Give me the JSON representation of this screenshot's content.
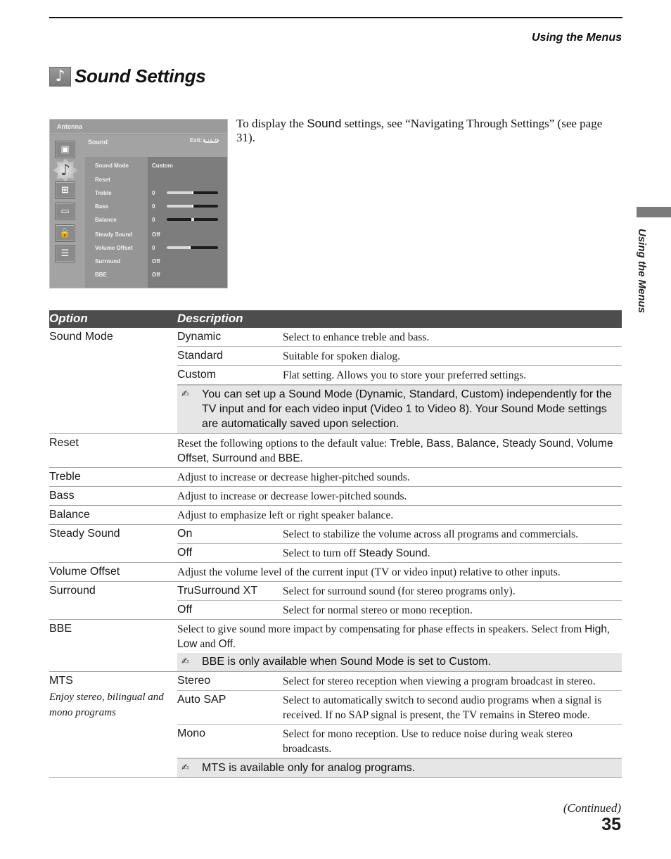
{
  "running_head": "Using the Menus",
  "section": {
    "icon": "music-note-icon",
    "icon_glyph": "♪",
    "title": "Sound Settings"
  },
  "tv_menu": {
    "source": "Antenna",
    "title": "Sound",
    "exit_label": "Exit:",
    "exit_key": "MENU",
    "rail_icons": [
      {
        "name": "picture-icon",
        "glyph": "▣"
      },
      {
        "name": "sound-icon",
        "glyph": "♪",
        "active": true
      },
      {
        "name": "screen-icon",
        "glyph": "⊞"
      },
      {
        "name": "channel-icon",
        "glyph": "▭"
      },
      {
        "name": "parental-lock-icon",
        "glyph": "🔒"
      },
      {
        "name": "setup-icon",
        "glyph": "☰"
      }
    ],
    "items": [
      {
        "label": "Sound Mode",
        "value": "Custom"
      },
      {
        "label": "Reset",
        "value": ""
      },
      {
        "label": "Treble",
        "value": "0",
        "slider": 0.5
      },
      {
        "label": "Bass",
        "value": "0",
        "slider": 0.5
      },
      {
        "label": "Balance",
        "value": "0",
        "balance": 0.5
      },
      {
        "label": "Steady Sound",
        "value": "Off"
      },
      {
        "label": "Volume Offset",
        "value": "0",
        "slider": 0.45
      },
      {
        "label": "Surround",
        "value": "Off"
      },
      {
        "label": "BBE",
        "value": "Off"
      }
    ]
  },
  "intro": {
    "before": "To display the ",
    "highlight": "Sound",
    "after": " settings, see “Navigating Through Settings” (see page 31)."
  },
  "side_tab": "Using the Menus",
  "table": {
    "header": {
      "option": "Option",
      "description": "Description"
    },
    "rows": [
      {
        "option": "Sound Mode",
        "subs": [
          {
            "name": "Dynamic",
            "text": "Select to enhance treble and bass."
          },
          {
            "name": "Standard",
            "text": "Suitable for spoken dialog."
          },
          {
            "name": "Custom",
            "text": "Flat setting. Allows you to store your preferred settings."
          }
        ],
        "note": "You can set up a Sound Mode (Dynamic, Standard, Custom) independently for the TV input and for each video input (Video 1 to Video 8). Your Sound Mode settings are automatically saved upon selection."
      },
      {
        "option": "Reset",
        "text_parts": [
          {
            "t": "Reset the following options to the default value: ",
            "sans": false
          },
          {
            "t": "Treble, Bass, Balance, Steady Sound, Volume Offset, Surround",
            "sans": true
          },
          {
            "t": " and ",
            "sans": false
          },
          {
            "t": "BBE",
            "sans": true
          },
          {
            "t": ".",
            "sans": false
          }
        ]
      },
      {
        "option": "Treble",
        "text": "Adjust to increase or decrease higher-pitched sounds."
      },
      {
        "option": "Bass",
        "text": "Adjust to increase or decrease lower-pitched sounds."
      },
      {
        "option": "Balance",
        "text": "Adjust to emphasize left or right speaker balance."
      },
      {
        "option": "Steady Sound",
        "subs": [
          {
            "name": "On",
            "text": "Select to stabilize the volume across all programs and commercials."
          },
          {
            "name": "Off",
            "text_parts": [
              {
                "t": "Select to turn off ",
                "sans": false
              },
              {
                "t": "Steady Sound",
                "sans": true
              },
              {
                "t": ".",
                "sans": false
              }
            ]
          }
        ]
      },
      {
        "option": "Volume Offset",
        "text": "Adjust the volume level of the current input (TV or video input) relative to other inputs."
      },
      {
        "option": "Surround",
        "subs": [
          {
            "name": "TruSurround XT",
            "text": "Select for surround sound (for stereo programs only)."
          },
          {
            "name": "Off",
            "text": "Select for normal stereo or mono reception."
          }
        ]
      },
      {
        "option": "BBE",
        "text_parts": [
          {
            "t": "Select to give sound more impact by compensating for phase effects in speakers. Select from ",
            "sans": false
          },
          {
            "t": "High",
            "sans": true
          },
          {
            "t": ", ",
            "sans": false
          },
          {
            "t": "Low",
            "sans": true
          },
          {
            "t": " and ",
            "sans": false
          },
          {
            "t": "Off",
            "sans": true
          },
          {
            "t": ".",
            "sans": false
          }
        ],
        "note": "BBE is only available when Sound Mode is set to Custom."
      },
      {
        "option": "MTS",
        "option_sub": "Enjoy stereo, bilingual and mono programs",
        "subs": [
          {
            "name": "Stereo",
            "text": "Select for stereo reception when viewing a program broadcast in stereo."
          },
          {
            "name": "Auto SAP",
            "text_parts": [
              {
                "t": "Select to automatically switch to second audio programs when a signal is received. If no SAP signal is present, the TV remains in ",
                "sans": false
              },
              {
                "t": "Stereo",
                "sans": true
              },
              {
                "t": " mode.",
                "sans": false
              }
            ]
          },
          {
            "name": "Mono",
            "text": "Select for mono reception. Use to reduce noise during weak stereo broadcasts."
          }
        ],
        "note": "MTS is available only for analog programs."
      }
    ]
  },
  "note_icon": "note-pencil-icon",
  "note_glyph": "✍",
  "continued": "(Continued)",
  "page_number": "35"
}
